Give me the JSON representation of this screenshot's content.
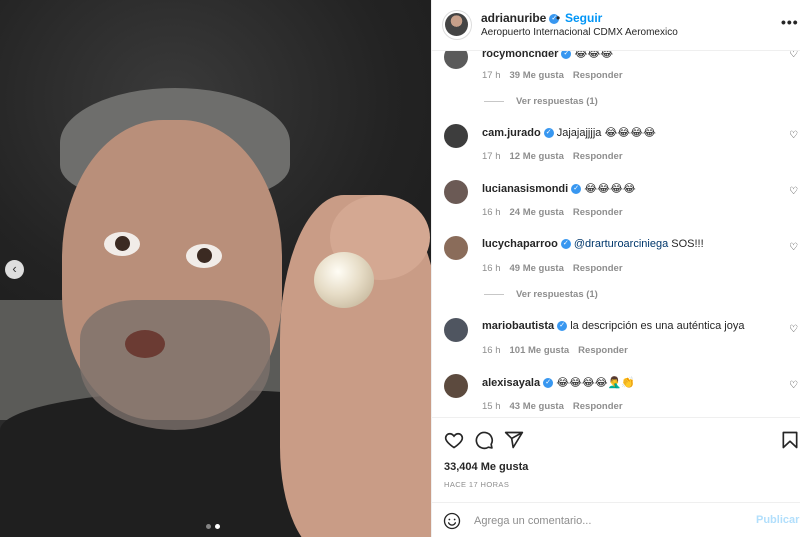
{
  "header": {
    "username": "adrianuribe",
    "dot": "•",
    "follow": "Seguir",
    "location": "Aeropuerto Internacional CDMX Aeromexico",
    "more": "•••"
  },
  "photo": {
    "nav_prev": "‹"
  },
  "comments": [
    {
      "user": "rocymoncnder",
      "text": "😂😂😂",
      "time": "17 h",
      "likes": "39 Me gusta",
      "reply": "Responder",
      "replies": "Ver respuestas (1)",
      "avatar_color": "#5a5a5a"
    },
    {
      "user": "cam.jurado",
      "text": "Jajajajjjja 😂😂😂😂",
      "time": "17 h",
      "likes": "12 Me gusta",
      "reply": "Responder",
      "avatar_color": "#3d3d3d"
    },
    {
      "user": "lucianasismondi",
      "text": "😂😂😂😂",
      "time": "16 h",
      "likes": "24 Me gusta",
      "reply": "Responder",
      "avatar_color": "#6b5a55"
    },
    {
      "user": "lucychaparroo",
      "mention": "@drarturoarciniega",
      "text": " SOS!!!",
      "time": "16 h",
      "likes": "49 Me gusta",
      "reply": "Responder",
      "replies": "Ver respuestas (1)",
      "avatar_color": "#8a6c5a"
    },
    {
      "user": "mariobautista",
      "text": "la descripción es una auténtica joya",
      "time": "16 h",
      "likes": "101 Me gusta",
      "reply": "Responder",
      "avatar_color": "#4f5560"
    },
    {
      "user": "alexisayala",
      "text": "😂😂😂😂🤦‍♂️👏",
      "time": "15 h",
      "likes": "43 Me gusta",
      "reply": "Responder",
      "avatar_color": "#5c4a3e"
    }
  ],
  "post": {
    "likes": "33,404 Me gusta",
    "ago": "HACE 17 HORAS"
  },
  "add_comment": {
    "placeholder": "Agrega un comentario...",
    "publish": "Publicar"
  },
  "colors": {
    "accent": "#0095f6",
    "verified": "#3897f0",
    "publish_disabled": "#b2dffc"
  }
}
